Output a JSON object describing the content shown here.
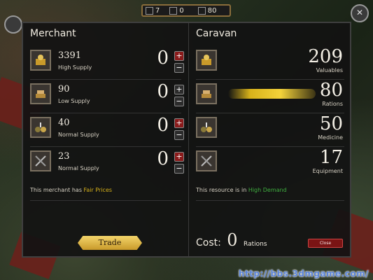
{
  "topbar": {
    "resources": [
      {
        "icon": "arrows-icon",
        "value": "7"
      },
      {
        "icon": "box-icon",
        "value": "0"
      },
      {
        "icon": "rations-icon",
        "value": "80"
      }
    ]
  },
  "merchant": {
    "title": "Merchant",
    "items": [
      {
        "icon": "valuables-icon",
        "quantity": "3391",
        "supply": "High Supply",
        "amount": "0"
      },
      {
        "icon": "rations-icon",
        "quantity": "90",
        "supply": "Low Supply",
        "amount": "0"
      },
      {
        "icon": "medicine-icon",
        "quantity": "40",
        "supply": "Normal Supply",
        "amount": "0"
      },
      {
        "icon": "equipment-icon",
        "quantity": "23",
        "supply": "Normal Supply",
        "amount": "0"
      }
    ],
    "plus_label": "+",
    "minus_label": "−",
    "note_prefix": "This merchant has ",
    "note_highlight": "Fair Prices",
    "trade_label": "Trade"
  },
  "caravan": {
    "title": "Caravan",
    "items": [
      {
        "icon": "valuables-icon",
        "amount": "209",
        "label": "Valuables"
      },
      {
        "icon": "rations-icon",
        "amount": "80",
        "label": "Rations",
        "highlighted": true
      },
      {
        "icon": "medicine-icon",
        "amount": "50",
        "label": "Medicine"
      },
      {
        "icon": "equipment-icon",
        "amount": "17",
        "label": "Equipment"
      }
    ],
    "note_prefix": "This resource is in ",
    "note_highlight": "High Demand",
    "cost_label": "Cost:",
    "cost_value": "0",
    "cost_unit": "Rations",
    "close_label": "Close"
  },
  "watermark": "http://bbs.3dmgame.com/",
  "colors": {
    "accent_gold": "#d8b21a",
    "demand_green": "#3fae3f",
    "close_red": "#7a1414"
  }
}
